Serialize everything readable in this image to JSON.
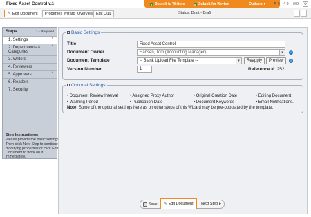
{
  "header": {
    "doc_title": "Fixed Asset Control v.1",
    "actions": {
      "submit_writers": "Submit to Writers",
      "submit_review": "Submit for Review",
      "options": "Options"
    },
    "counts": {
      "flags": "0",
      "attachments": "0",
      "comments": "0"
    }
  },
  "toolbar": {
    "edit_document": "Edit Document",
    "tabs": [
      "Properties Wizard",
      "Overview",
      "Edit Quiz"
    ],
    "status": "Status: Draft - Draft"
  },
  "steps": {
    "title": "Steps",
    "required_legend": "* = Required",
    "items": [
      {
        "label": "1. Settings",
        "required": "*"
      },
      {
        "label": "2. Departments & Categories",
        "required": "*"
      },
      {
        "label": "3. Writers",
        "required": ""
      },
      {
        "label": "4. Reviewers",
        "required": ""
      },
      {
        "label": "5. Approvers",
        "required": "*"
      },
      {
        "label": "6. Readers",
        "required": ""
      },
      {
        "label": "7. Security",
        "required": ""
      }
    ],
    "instructions_title": "Step Instructions:",
    "instructions_text": "Please provide the basic settings. Then click Next Step to continue modifying properties or click Edit Document to work on it immediately."
  },
  "basic_settings": {
    "legend": "Basic Settings",
    "title_label": "Title",
    "title_value": "Fixed Asset Control",
    "owner_label": "Document Owner",
    "owner_value": "Hansen, Tom (Accounting Manager)",
    "template_label": "Document Template",
    "template_value": "-- Blank Upload File Template --",
    "reapply": "Reapply",
    "preview": "Preview",
    "version_label": "Version Number",
    "version_value": "1",
    "reference_label": "Reference #",
    "reference_value": "252"
  },
  "optional_settings": {
    "legend": "Optional Settings",
    "row1": [
      "• Document Review Interval",
      "• Assigned Proxy Author",
      "• Original Creation Date",
      "• Editing Document"
    ],
    "row2": [
      "• Warning Period",
      "• Publication Date",
      "• Document Keywords",
      "• Email Notifications."
    ],
    "note_label": "Note:",
    "note_text": "Some of the optional settings here as on other steps of this Wizard may be pre-populated by the template."
  },
  "footer": {
    "save": "Save",
    "edit_document": "Edit Document",
    "next_step": "Next Step"
  },
  "colors": {
    "accent_orange": "#f08a1e",
    "link_blue": "#2a5db0",
    "info_blue": "#1d6fc6"
  }
}
